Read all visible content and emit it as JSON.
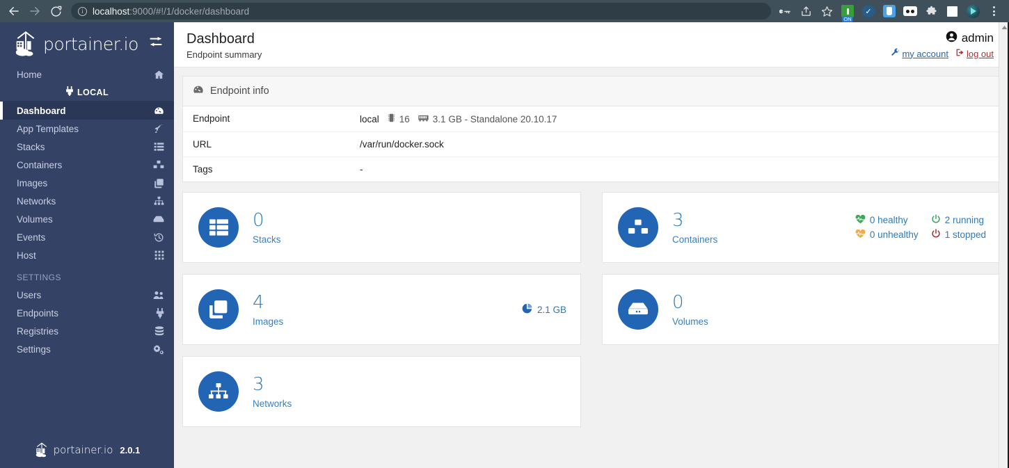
{
  "browser": {
    "back_icon": "back-arrow-icon",
    "forward_icon": "forward-arrow-icon",
    "reload_icon": "reload-icon",
    "url_host": "localhost",
    "url_rest": ":9000/#!/1/docker/dashboard",
    "url_full": "localhost:9000/#!/1/docker/dashboard",
    "toolbar_icons": [
      "key-icon",
      "share-icon",
      "bookmark-star-icon",
      "extension-on-icon",
      "extension-check-icon",
      "extension-bag-icon",
      "extension-goggles-icon",
      "extension-puzzle-icon",
      "extension-square-icon",
      "extension-teal-icon",
      "chrome-menu-icon"
    ]
  },
  "sidebar": {
    "brand": "portainer.io",
    "toggle_icon": "collapse-toggle-icon",
    "home": {
      "label": "Home",
      "icon": "home-icon"
    },
    "environment": {
      "label": "LOCAL",
      "icon": "plug-icon"
    },
    "items": [
      {
        "label": "Dashboard",
        "icon": "dashboard-icon",
        "active": true
      },
      {
        "label": "App Templates",
        "icon": "rocket-icon",
        "active": false
      },
      {
        "label": "Stacks",
        "icon": "list-icon",
        "active": false
      },
      {
        "label": "Containers",
        "icon": "containers-icon",
        "active": false
      },
      {
        "label": "Images",
        "icon": "images-icon",
        "active": false
      },
      {
        "label": "Networks",
        "icon": "network-icon",
        "active": false
      },
      {
        "label": "Volumes",
        "icon": "volume-icon",
        "active": false
      },
      {
        "label": "Events",
        "icon": "history-icon",
        "active": false
      },
      {
        "label": "Host",
        "icon": "grid-icon",
        "active": false
      }
    ],
    "settings_title": "SETTINGS",
    "settings_items": [
      {
        "label": "Users",
        "icon": "users-icon"
      },
      {
        "label": "Endpoints",
        "icon": "plug-icon"
      },
      {
        "label": "Registries",
        "icon": "database-icon"
      },
      {
        "label": "Settings",
        "icon": "gears-icon"
      }
    ],
    "footer_brand": "portainer.io",
    "version": "2.0.1"
  },
  "header": {
    "title": "Dashboard",
    "subtitle": "Endpoint summary",
    "user": "admin",
    "user_icon": "user-circle-icon",
    "my_account": "my account",
    "my_account_icon": "wrench-icon",
    "log_out": "log out",
    "log_out_icon": "sign-out-icon"
  },
  "endpoint_panel": {
    "title": "Endpoint info",
    "title_icon": "tachometer-icon",
    "rows": [
      {
        "label": "Endpoint",
        "value": "local",
        "cpu_icon": "cpu-icon",
        "cpu": "16",
        "memory_icon": "memory-icon",
        "memory": "3.1 GB - Standalone 20.10.17"
      },
      {
        "label": "URL",
        "value": "/var/run/docker.sock"
      },
      {
        "label": "Tags",
        "value": "-"
      }
    ]
  },
  "cards": [
    {
      "name": "stacks",
      "count": "0",
      "label": "Stacks",
      "icon": "stacks-icon"
    },
    {
      "name": "containers",
      "count": "3",
      "label": "Containers",
      "icon": "containers-icon",
      "statuses": [
        {
          "icon": "heartbeat-green-icon",
          "text": "0 healthy",
          "color": "#3aaa5a"
        },
        {
          "icon": "power-green-icon",
          "text": "2 running",
          "color": "#23a455"
        },
        {
          "icon": "heartbeat-orange-icon",
          "text": "0 unhealthy",
          "color": "#f0ad4e"
        },
        {
          "icon": "power-red-icon",
          "text": "1 stopped",
          "color": "#a82020"
        }
      ]
    },
    {
      "name": "images",
      "count": "4",
      "label": "Images",
      "icon": "images-icon",
      "size_icon": "pie-chart-icon",
      "size": "2.1 GB"
    },
    {
      "name": "volumes",
      "count": "0",
      "label": "Volumes",
      "icon": "volume-icon"
    },
    {
      "name": "networks",
      "count": "3",
      "label": "Networks",
      "icon": "network-icon"
    }
  ],
  "colors": {
    "sidebar_bg": "#344266",
    "sidebar_active_bg": "#2b3756",
    "accent_blue": "#2265b5",
    "card_num_blue": "#2e7ab8",
    "card_label_blue": "#3a7fbe",
    "page_bg": "#f1f1f1",
    "browser_bg": "#40505a"
  }
}
